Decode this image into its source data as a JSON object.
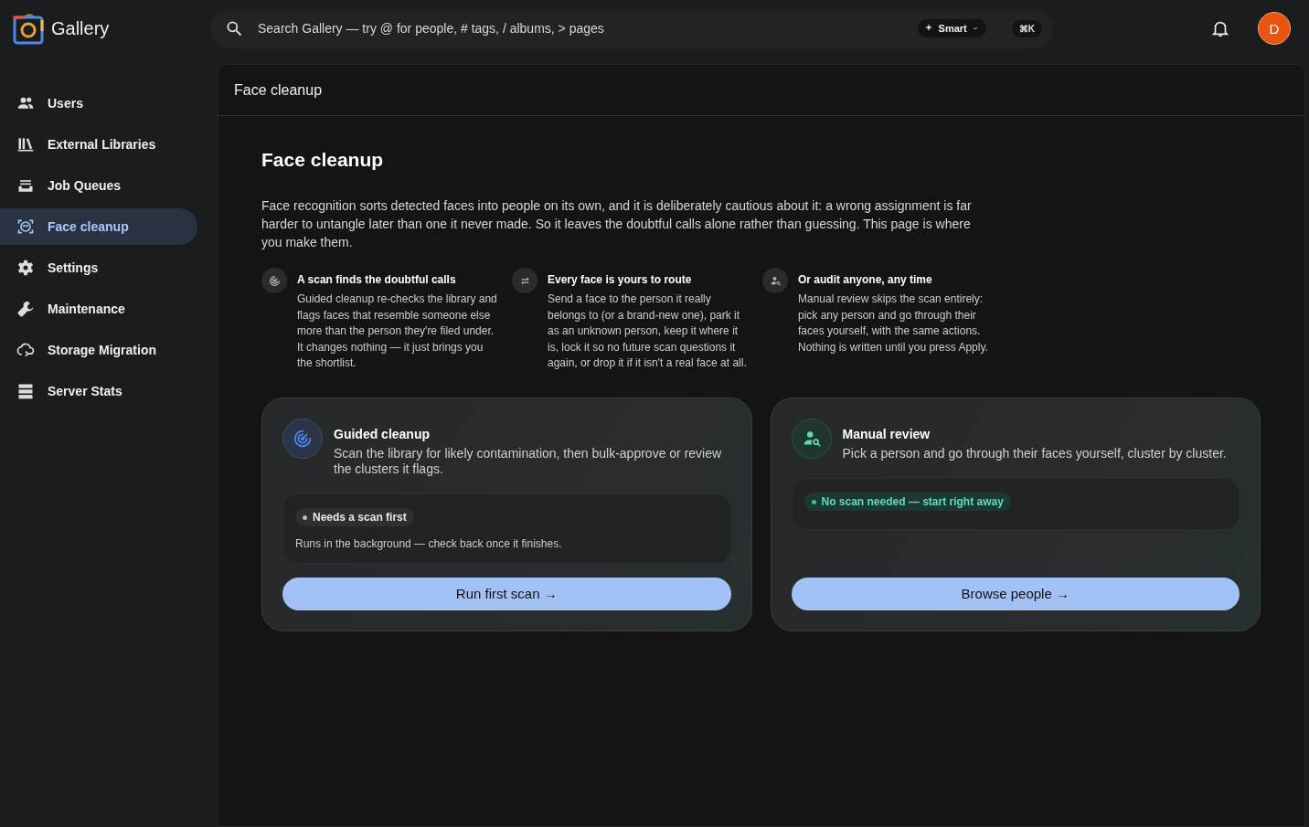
{
  "app": {
    "name": "Gallery"
  },
  "search": {
    "placeholder": "Search Gallery — try @ for people, # tags, / albums, > pages",
    "mode": "Smart",
    "shortcut": "⌘K"
  },
  "user": {
    "initial": "D"
  },
  "sidebar": {
    "items": [
      {
        "label": "Users",
        "selected": false
      },
      {
        "label": "External Libraries",
        "selected": false
      },
      {
        "label": "Job Queues",
        "selected": false
      },
      {
        "label": "Face cleanup",
        "selected": true
      },
      {
        "label": "Settings",
        "selected": false
      },
      {
        "label": "Maintenance",
        "selected": false
      },
      {
        "label": "Storage Migration",
        "selected": false
      },
      {
        "label": "Server Stats",
        "selected": false
      }
    ]
  },
  "page": {
    "header": "Face cleanup",
    "title": "Face cleanup",
    "intro": "Face recognition sorts detected faces into people on its own, and it is deliberately cautious about it: a wrong assignment is far harder to untangle later than one it never made. So it leaves the doubtful calls alone rather than guessing. This page is where you make them.",
    "features": [
      {
        "title": "A scan finds the doubtful calls",
        "text": "Guided cleanup re-checks the library and flags faces that resemble someone else more than the person they're filed under. It changes nothing — it just brings you the shortlist."
      },
      {
        "title": "Every face is yours to route",
        "text": "Send a face to the person it really belongs to (or a brand-new one), park it as an unknown person, keep it where it is, lock it so no future scan questions it again, or drop it if it isn't a real face at all."
      },
      {
        "title": "Or audit anyone, any time",
        "text": "Manual review skips the scan entirely: pick any person and go through their faces yourself, with the same actions. Nothing is written until you press Apply."
      }
    ],
    "cards": [
      {
        "title": "Guided cleanup",
        "text": "Scan the library for likely contamination, then bulk-approve or review the clusters it flags.",
        "status": {
          "kind": "pending",
          "label": "Needs a scan first"
        },
        "note": "Runs in the background — check back once it finishes.",
        "button": "Run first scan →"
      },
      {
        "title": "Manual review",
        "text": "Pick a person and go through their faces yourself, cluster by cluster.",
        "status": {
          "kind": "ready",
          "label": "No scan needed — start right away"
        },
        "button": "Browse people →"
      }
    ]
  }
}
